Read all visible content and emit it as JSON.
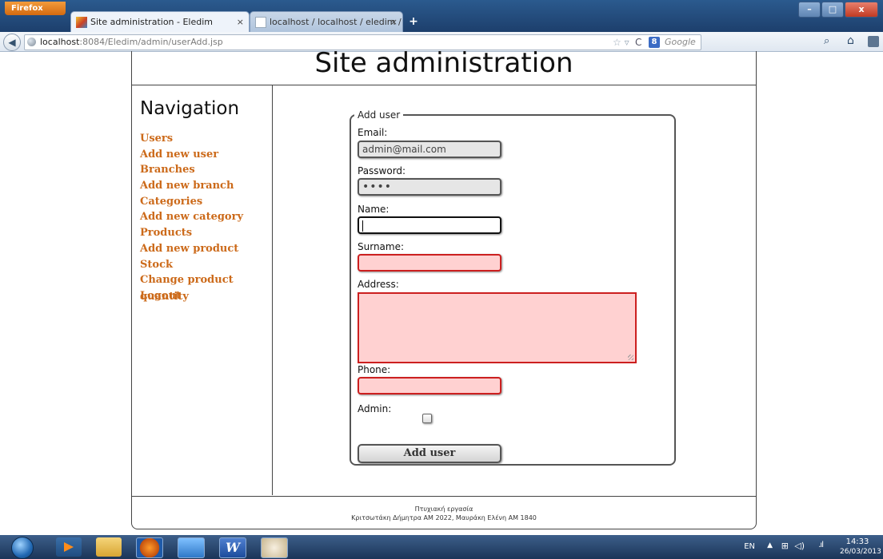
{
  "browser": {
    "menu_button": "Firefox",
    "tabs": [
      {
        "label": "Site administration - Eledim",
        "active": true
      },
      {
        "label": "localhost / localhost / eledim / users |...",
        "active": false
      }
    ],
    "tab_close": "×",
    "new_tab": "+",
    "window_controls": {
      "minimize": "–",
      "maximize": "□",
      "close": "x"
    },
    "url_host": "localhost",
    "url_path": ":8084/Eledim/admin/userAdd.jsp",
    "search_engine_badge": "8",
    "search_placeholder": "Google"
  },
  "page": {
    "title": "Site administration",
    "navigation": {
      "heading": "Navigation",
      "items": [
        {
          "label": "Users"
        },
        {
          "label": "Add new user"
        },
        {
          "label": "Branches"
        },
        {
          "label": "Add new branch"
        },
        {
          "label": "Categories"
        },
        {
          "label": "Add new category"
        },
        {
          "label": "Products"
        },
        {
          "label": "Add new product"
        },
        {
          "label": "Stock"
        },
        {
          "label": "Change product quantity"
        },
        {
          "label": "Logout"
        }
      ]
    },
    "form": {
      "legend": "Add user",
      "email_label": "Email:",
      "email_value": "admin@mail.com",
      "password_label": "Password:",
      "password_value": "••••",
      "name_label": "Name:",
      "surname_label": "Surname:",
      "address_label": "Address:",
      "phone_label": "Phone:",
      "admin_label": "Admin:",
      "submit_label": "Add user"
    },
    "footer": {
      "line1": "Πτυχιακή εργασία",
      "line2": "Κριτσωτάκη Δήμητρα ΑΜ 2022, Μαυράκη Ελένη ΑΜ 1840"
    }
  },
  "taskbar": {
    "language": "EN",
    "time": "14:33",
    "date": "26/03/2013"
  },
  "colors": {
    "nav_link": "#cc6a1a",
    "invalid_fill": "#ffd1d1",
    "invalid_border": "#cc1f1f"
  }
}
